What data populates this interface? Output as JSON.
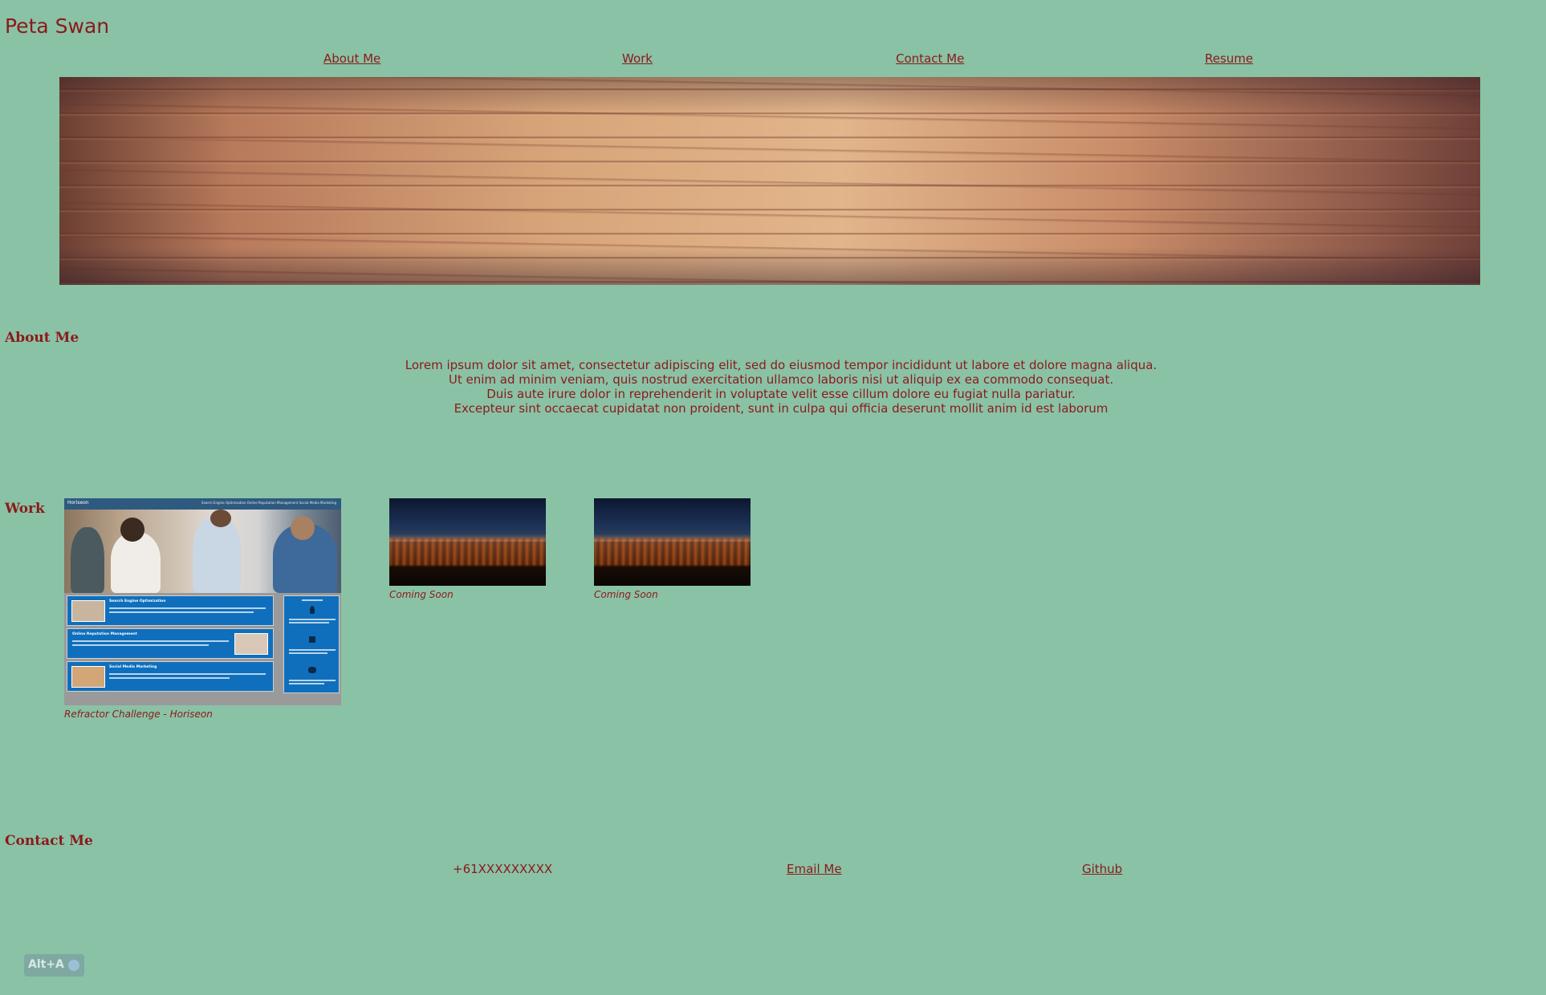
{
  "header": {
    "site_title": "Peta Swan",
    "nav": [
      "About Me",
      "Work",
      "Contact Me",
      "Resume"
    ]
  },
  "about": {
    "heading": "About Me",
    "lines": [
      "Lorem ipsum dolor sit amet, consectetur adipiscing elit, sed do eiusmod tempor incididunt ut labore et dolore magna aliqua.",
      "Ut enim ad minim veniam, quis nostrud exercitation ullamco laboris nisi ut aliquip ex ea commodo consequat.",
      "Duis aute irure dolor in reprehenderit in voluptate velit esse cillum dolore eu fugiat nulla pariatur.",
      "Excepteur sint occaecat cupidatat non proident, sunt in culpa qui officia deserunt mollit anim id est laborum"
    ]
  },
  "work": {
    "heading": "Work",
    "items": [
      {
        "caption": "Refractor Challenge - Horiseon"
      },
      {
        "caption": "Coming Soon"
      },
      {
        "caption": "Coming Soon"
      }
    ],
    "horiseon_thumb": {
      "logo": "Horiseon",
      "nav": "Search Engine Optimization   Online Reputation Management   Social Media Marketing",
      "cards": [
        "Search Engine Optimization",
        "Online Reputation Management",
        "Social Media Marketing"
      ]
    }
  },
  "contact": {
    "heading": "Contact Me",
    "phone": "+61XXXXXXXXX",
    "email_label": "Email Me",
    "github_label": "Github"
  },
  "widget": {
    "label": "Alt+A"
  },
  "colors": {
    "background": "#8ac2a6",
    "text": "#8b1a1a"
  }
}
